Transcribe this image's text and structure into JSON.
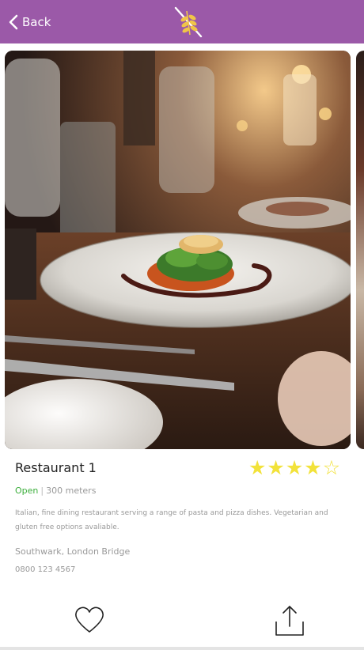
{
  "header": {
    "back_label": "Back",
    "brand_color": "#9b59a8",
    "logo_icon": "wheat-slash-icon"
  },
  "restaurant": {
    "name": "Restaurant 1",
    "rating": 4,
    "rating_max": 5,
    "status": "Open",
    "separator": "|",
    "distance": "300 meters",
    "description": "Italian, fine dining restaurant serving a range of pasta and pizza dishes. Vegetarian and gluten free options avaliable.",
    "address": "Southwark, London Bridge",
    "phone": "0800 123 4567"
  },
  "actions": {
    "favorite_icon": "heart-icon",
    "share_icon": "share-icon"
  },
  "colors": {
    "brand": "#9b59a8",
    "open": "#3cae3c",
    "star": "#f2e23a"
  }
}
